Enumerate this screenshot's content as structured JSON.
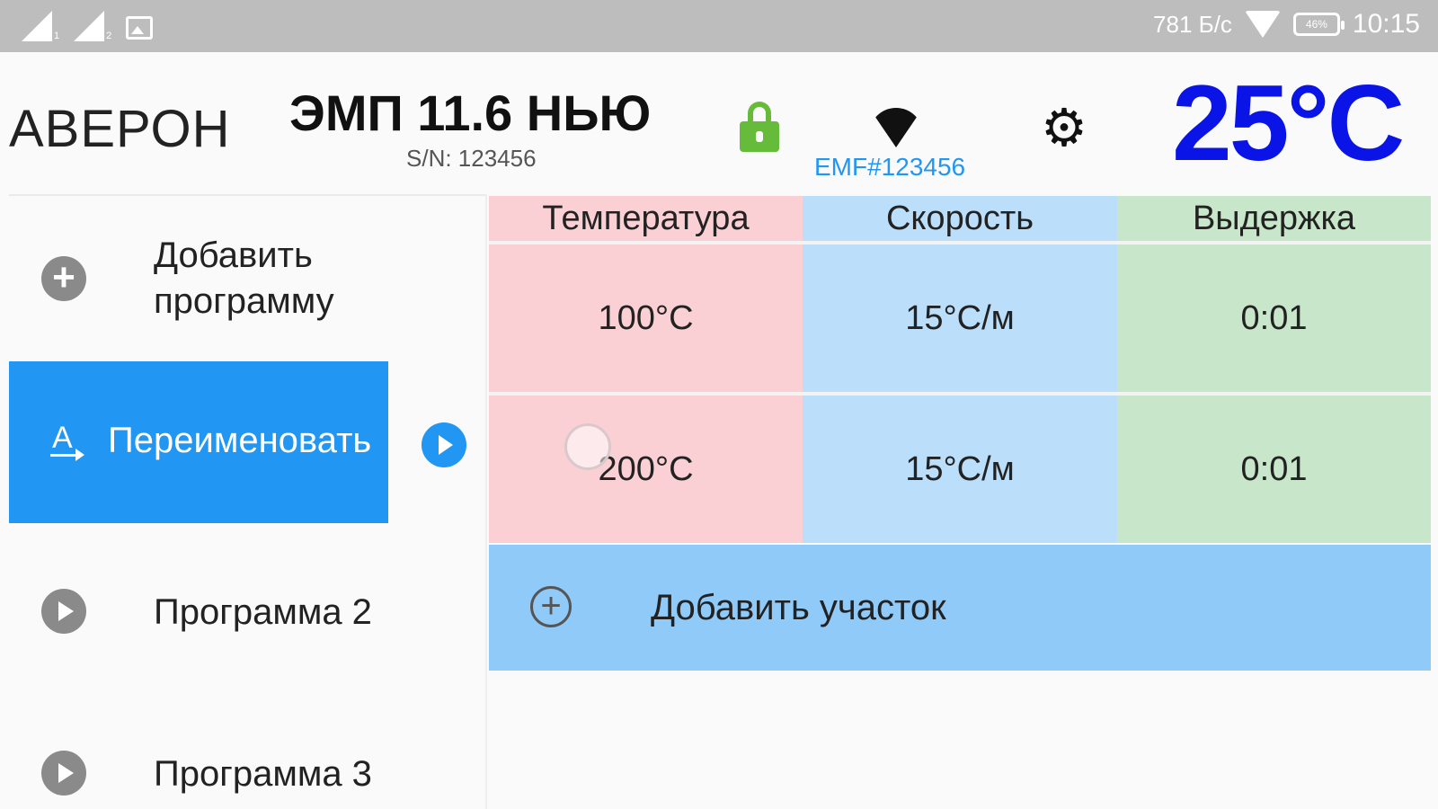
{
  "status_bar": {
    "sim1": "1",
    "sim2": "2",
    "speed": "781 Б/с",
    "battery": "46%",
    "time": "10:15"
  },
  "header": {
    "brand": "АВЕРОН",
    "model": "ЭМП 11.6 НЬЮ",
    "serial": "S/N: 123456",
    "wifi_name": "EMF#123456",
    "temperature": "25°C",
    "gear_glyph": "⚙",
    "colors": {
      "temperature": "#0a14e6",
      "lock": "#66bb3a",
      "accent": "#2196f3"
    }
  },
  "sidebar": {
    "add_program": "Добавить программу",
    "rename": "Переименовать",
    "items": [
      {
        "label": "Программа 2"
      },
      {
        "label": "Программа 3"
      }
    ]
  },
  "table": {
    "headers": [
      "Температура",
      "Скорость",
      "Выдержка"
    ],
    "rows": [
      [
        "100°C",
        "15°C/м",
        "0:01"
      ],
      [
        "200°C",
        "15°C/м",
        "0:01"
      ]
    ],
    "add_section": "Добавить участок",
    "colors": {
      "temperature": "#fbd0d4",
      "speed": "#bbdefa",
      "hold": "#c8e6c9",
      "add_bar": "#90caf9"
    }
  }
}
